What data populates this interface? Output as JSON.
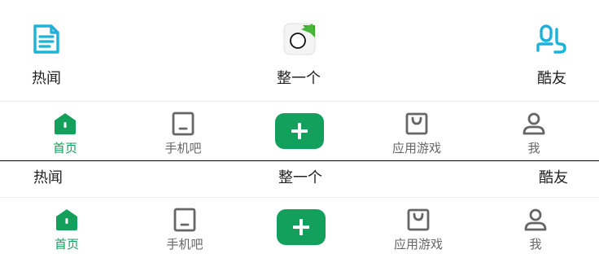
{
  "top_entries": [
    {
      "label": "热闻",
      "icon": "document-list-icon"
    },
    {
      "label": "整一个",
      "icon": "app-thumbnail-icon"
    },
    {
      "label": "酷友",
      "icon": "friends-icon"
    }
  ],
  "tab_bar_1": {
    "tabs": [
      {
        "label": "首页",
        "icon": "home-icon",
        "active": true
      },
      {
        "label": "手机吧",
        "icon": "phone-icon",
        "active": false
      },
      {
        "label": "",
        "icon": "plus-icon",
        "active": false
      },
      {
        "label": "应用游戏",
        "icon": "shopping-bag-icon",
        "active": false
      },
      {
        "label": "我",
        "icon": "user-icon",
        "active": false
      }
    ]
  },
  "labels_row": [
    {
      "label": "热闻"
    },
    {
      "label": "整一个"
    },
    {
      "label": "酷友"
    }
  ],
  "tab_bar_2": {
    "tabs": [
      {
        "label": "首页",
        "icon": "home-icon",
        "active": true
      },
      {
        "label": "手机吧",
        "icon": "phone-icon",
        "active": false
      },
      {
        "label": "",
        "icon": "plus-icon",
        "active": false
      },
      {
        "label": "应用游戏",
        "icon": "shopping-bag-icon",
        "active": false
      },
      {
        "label": "我",
        "icon": "user-icon",
        "active": false
      }
    ]
  },
  "colors": {
    "accent": "#12a05c",
    "top_icon": "#1bb3d6",
    "tab_inactive": "#666666",
    "text": "#222222"
  }
}
